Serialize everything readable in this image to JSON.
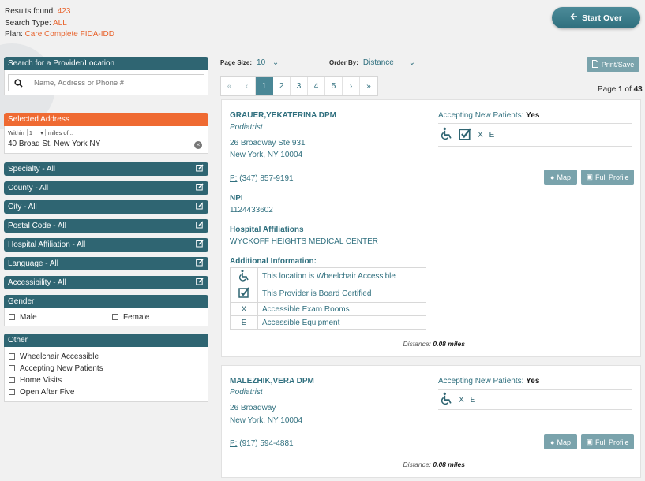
{
  "summary": {
    "results_label": "Results found:",
    "results_value": "423",
    "type_label": "Search Type:",
    "type_value": "ALL",
    "plan_label": "Plan:",
    "plan_value": "Care Complete FIDA-IDD"
  },
  "start_over_label": "Start Over",
  "search": {
    "header": "Search for a Provider/Location",
    "placeholder": "Name, Address or Phone #"
  },
  "address": {
    "header": "Selected Address",
    "within_label": "Within",
    "within_value": "1",
    "miles_label": "miles of...",
    "value": "40 Broad St, New York NY"
  },
  "filters": [
    "Specialty - All",
    "County - All",
    "City - All",
    "Postal Code - All",
    "Hospital Affiliation - All",
    "Language - All",
    "Accessibility - All"
  ],
  "gender": {
    "header": "Gender",
    "options": [
      "Male",
      "Female"
    ]
  },
  "other": {
    "header": "Other",
    "options": [
      "Wheelchair Accessible",
      "Accepting New Patients",
      "Home Visits",
      "Open After Five"
    ]
  },
  "toolbar": {
    "page_size_label": "Page Size:",
    "page_size_value": "10",
    "order_by_label": "Order By:",
    "order_by_value": "Distance",
    "print_label": "Print/Save"
  },
  "pagination": {
    "pages": [
      "1",
      "2",
      "3",
      "4",
      "5"
    ],
    "current": "1",
    "page_of_prefix": "Page",
    "page_current": "1",
    "page_of_mid": "of",
    "page_total": "43"
  },
  "providers": [
    {
      "name": "GRAUER,YEKATERINA DPM",
      "specialty": "Podiatrist",
      "address1": "26 Broadway Ste 931",
      "address2": "New York, NY 10004",
      "phone_prefix": "P:",
      "phone": "(347) 857-9191",
      "npi_label": "NPI",
      "npi": "1124433602",
      "hospital_label": "Hospital Affiliations",
      "hospital": "WYCKOFF HEIGHTS MEDICAL CENTER",
      "additional_label": "Additional Information:",
      "additional": [
        {
          "icon": "wheelchair-icon",
          "text": "This location is Wheelchair Accessible"
        },
        {
          "icon": "checkbox-icon",
          "text": "This Provider is Board Certified"
        },
        {
          "icon": "X",
          "text": "Accessible Exam Rooms"
        },
        {
          "icon": "E",
          "text": "Accessible Equipment"
        }
      ],
      "accepting_label": "Accepting New Patients:",
      "accepting_value": "Yes",
      "icon_x": "X",
      "icon_e": "E",
      "map_label": "Map",
      "profile_label": "Full Profile",
      "distance_label": "Distance:",
      "distance_value": "0.08 miles"
    },
    {
      "name": "MALEZHIK,VERA DPM",
      "specialty": "Podiatrist",
      "address1": "26 Broadway",
      "address2": "New York, NY 10004",
      "phone_prefix": "P:",
      "phone": "(917) 594-4881",
      "accepting_label": "Accepting New Patients:",
      "accepting_value": "Yes",
      "icon_x": "X",
      "icon_e": "E",
      "map_label": "Map",
      "profile_label": "Full Profile",
      "distance_label": "Distance:",
      "distance_value": "0.08 miles"
    }
  ],
  "colors": {
    "teal_dark": "#2f6572",
    "teal_text": "#2f6f7e",
    "orange": "#e8622b",
    "button_light": "#7aa3ac"
  }
}
